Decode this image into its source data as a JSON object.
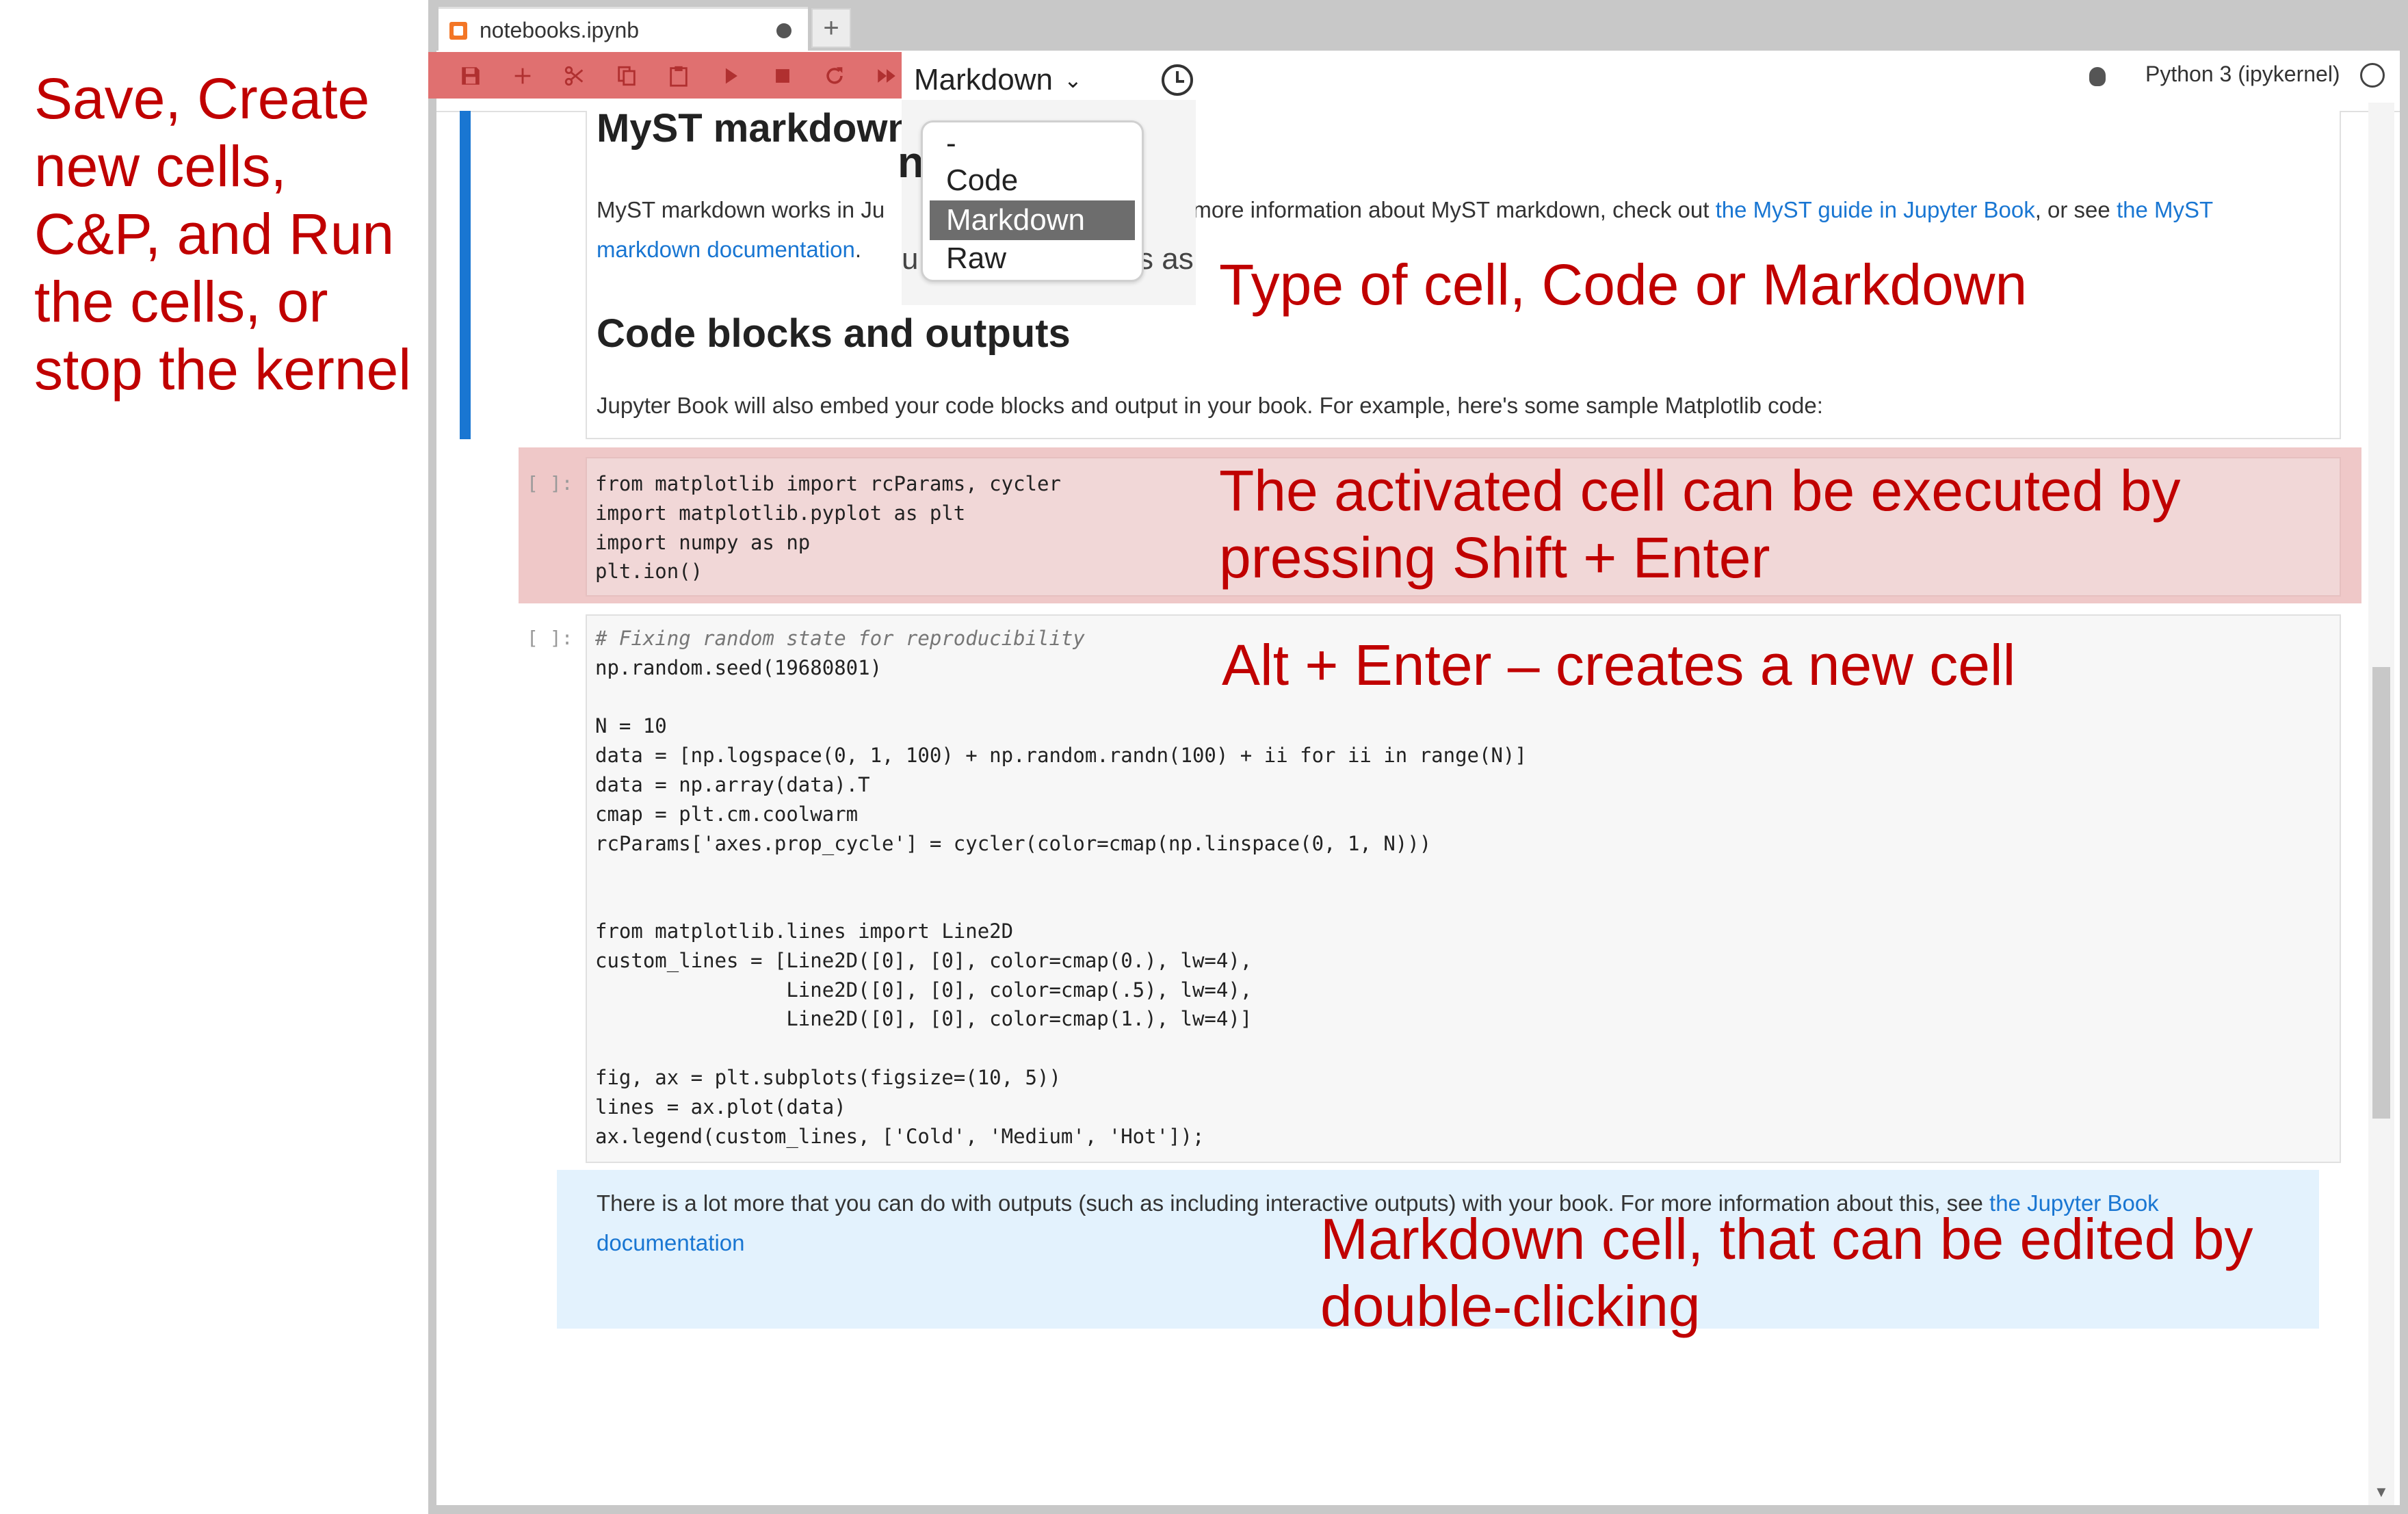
{
  "annotations": {
    "left": [
      "Save, Create",
      "new cells,",
      "C&P, and Run",
      "the cells, or",
      "stop the kernel"
    ],
    "cell_type": "Type of cell, Code or Markdown",
    "run": [
      "The activated cell can be executed by",
      "pressing Shift + Enter"
    ],
    "alt_enter": "Alt + Enter – creates a new cell",
    "markdown": [
      "Markdown cell, that can be edited by",
      "double-clicking"
    ]
  },
  "tab": {
    "title": "notebooks.ipynb",
    "new_tab_label": "+"
  },
  "toolbar": {
    "icons": [
      "save-icon",
      "add-cell-icon",
      "cut-icon",
      "copy-icon",
      "paste-icon",
      "run-icon",
      "stop-icon",
      "restart-icon",
      "fast-forward-icon"
    ],
    "cell_type_value": "Markdown",
    "chevron": "⌄",
    "kernel_name": "Python 3 (ipykernel)"
  },
  "dropdown": {
    "options": [
      "-",
      "Code",
      "Markdown",
      "Raw"
    ],
    "selected": "Markdown"
  },
  "markdown_cell": {
    "heading1": "MyST markdown",
    "hidden_n": "n",
    "hidden_as": "u",
    "hidden_s": "s as",
    "p1_part1": "MyST markdown works in Ju",
    "p1_part2": "r more information about MyST markdown, check out ",
    "p1_link1": "the MyST guide in Jupyter Book",
    "p1_part3": ", or see ",
    "p1_link2": "the MyST",
    "p1_link3": "markdown documentation",
    "p1_end": ".",
    "heading2": "Code blocks and outputs",
    "p2": "Jupyter Book will also embed your code blocks and output in your book. For example, here's some sample Matplotlib code:"
  },
  "code_cell_1": {
    "prompt": "[ ]:",
    "lines": [
      "from matplotlib import rcParams, cycler",
      "import matplotlib.pyplot as plt",
      "import numpy as np",
      "plt.ion()"
    ]
  },
  "code_cell_2": {
    "prompt": "[ ]:",
    "lines": [
      "# Fixing random state for reproducibility",
      "np.random.seed(19680801)",
      "",
      "N = 10",
      "data = [np.logspace(0, 1, 100) + np.random.randn(100) + ii for ii in range(N)]",
      "data = np.array(data).T",
      "cmap = plt.cm.coolwarm",
      "rcParams['axes.prop_cycle'] = cycler(color=cmap(np.linspace(0, 1, N)))",
      "",
      "",
      "from matplotlib.lines import Line2D",
      "custom_lines = [Line2D([0], [0], color=cmap(0.), lw=4),",
      "                Line2D([0], [0], color=cmap(.5), lw=4),",
      "                Line2D([0], [0], color=cmap(1.), lw=4)]",
      "",
      "fig, ax = plt.subplots(figsize=(10, 5))",
      "lines = ax.plot(data)",
      "ax.legend(custom_lines, ['Cold', 'Medium', 'Hot']);"
    ]
  },
  "markdown_note": {
    "text": "There is a lot more that you can do with outputs (such as including interactive outputs) with your book. For more information about this, see ",
    "link_part1": "the Jupyter Book",
    "link_part2": "documentation"
  },
  "colors": {
    "annotation": "#c00000",
    "active_cell": "#1976d2",
    "toolbar_highlight": "#e07070",
    "link": "#1976d2"
  }
}
